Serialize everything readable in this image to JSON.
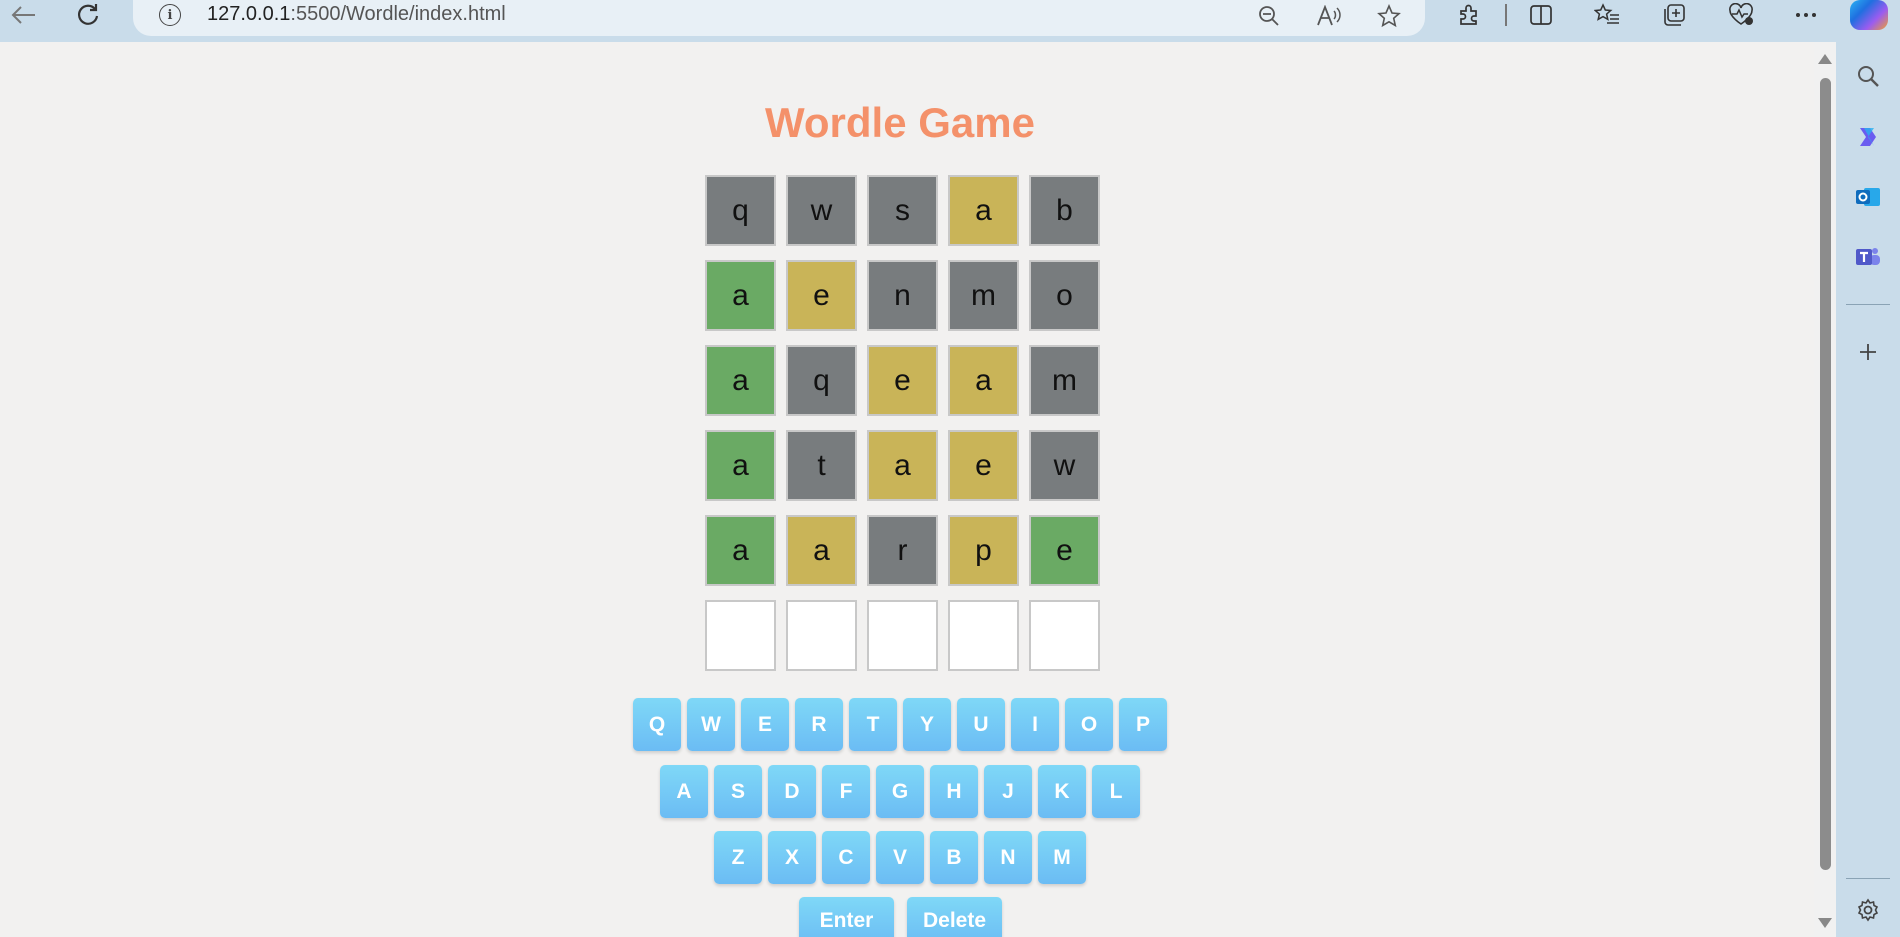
{
  "browser": {
    "url_host": "127.0.0.1",
    "url_rest": ":5500/Wordle/index.html"
  },
  "game": {
    "title": "Wordle Game",
    "rows": [
      [
        {
          "l": "q",
          "s": "gray"
        },
        {
          "l": "w",
          "s": "gray"
        },
        {
          "l": "s",
          "s": "gray"
        },
        {
          "l": "a",
          "s": "yellow"
        },
        {
          "l": "b",
          "s": "gray"
        }
      ],
      [
        {
          "l": "a",
          "s": "green"
        },
        {
          "l": "e",
          "s": "yellow"
        },
        {
          "l": "n",
          "s": "gray"
        },
        {
          "l": "m",
          "s": "gray"
        },
        {
          "l": "o",
          "s": "gray"
        }
      ],
      [
        {
          "l": "a",
          "s": "green"
        },
        {
          "l": "q",
          "s": "gray"
        },
        {
          "l": "e",
          "s": "yellow"
        },
        {
          "l": "a",
          "s": "yellow"
        },
        {
          "l": "m",
          "s": "gray"
        }
      ],
      [
        {
          "l": "a",
          "s": "green"
        },
        {
          "l": "t",
          "s": "gray"
        },
        {
          "l": "a",
          "s": "yellow"
        },
        {
          "l": "e",
          "s": "yellow"
        },
        {
          "l": "w",
          "s": "gray"
        }
      ],
      [
        {
          "l": "a",
          "s": "green"
        },
        {
          "l": "a",
          "s": "yellow"
        },
        {
          "l": "r",
          "s": "gray"
        },
        {
          "l": "p",
          "s": "yellow"
        },
        {
          "l": "e",
          "s": "green"
        }
      ],
      [
        {
          "l": "",
          "s": "empty"
        },
        {
          "l": "",
          "s": "empty"
        },
        {
          "l": "",
          "s": "empty"
        },
        {
          "l": "",
          "s": "empty"
        },
        {
          "l": "",
          "s": "empty"
        }
      ]
    ],
    "colors": {
      "gray": "#787c7e",
      "yellow": "#c9b458",
      "green": "#6aaa64",
      "title": "#f4916a",
      "key": "#7fd8f7"
    }
  },
  "keyboard": {
    "row1": [
      "Q",
      "W",
      "E",
      "R",
      "T",
      "Y",
      "U",
      "I",
      "O",
      "P"
    ],
    "row2": [
      "A",
      "S",
      "D",
      "F",
      "G",
      "H",
      "J",
      "K",
      "L"
    ],
    "row3": [
      "Z",
      "X",
      "C",
      "V",
      "B",
      "N",
      "M"
    ],
    "enter_label": "Enter",
    "delete_label": "Delete"
  }
}
